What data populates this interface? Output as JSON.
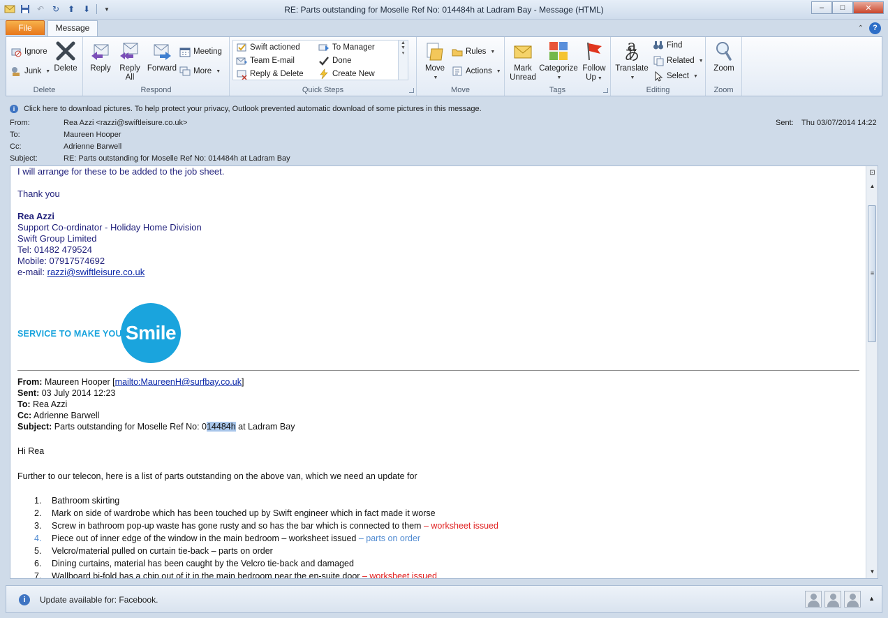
{
  "window": {
    "title": "RE: Parts outstanding for Moselle Ref No:  014484h at Ladram Bay  -  Message (HTML)",
    "controls": {
      "minimize": "–",
      "maximize": "□",
      "close": "✕"
    }
  },
  "tabs": {
    "file": "File",
    "message": "Message"
  },
  "ribbon": {
    "delete_group": {
      "label": "Delete",
      "ignore": "Ignore",
      "junk": "Junk",
      "delete": "Delete"
    },
    "respond_group": {
      "label": "Respond",
      "reply": "Reply",
      "reply_all_1": "Reply",
      "reply_all_2": "All",
      "forward": "Forward",
      "meeting": "Meeting",
      "more": "More"
    },
    "quick_steps": {
      "label": "Quick Steps",
      "items": [
        "Swift actioned",
        "To Manager",
        "Team E-mail",
        "Done",
        "Reply & Delete",
        "Create New"
      ]
    },
    "move_group": {
      "label": "Move",
      "move": "Move",
      "rules": "Rules",
      "actions": "Actions"
    },
    "tags_group": {
      "label": "Tags",
      "mark_unread_1": "Mark",
      "mark_unread_2": "Unread",
      "categorize": "Categorize",
      "follow_up_1": "Follow",
      "follow_up_2": "Up"
    },
    "editing_group": {
      "label": "Editing",
      "translate": "Translate",
      "find": "Find",
      "related": "Related",
      "select": "Select"
    },
    "zoom_group": {
      "label": "Zoom",
      "zoom": "Zoom"
    }
  },
  "infobar": {
    "text": "Click here to download pictures. To help protect your privacy, Outlook prevented automatic download of some pictures in this message."
  },
  "headers": {
    "from_label": "From:",
    "from_value": "Rea Azzi <razzi@swiftleisure.co.uk>",
    "to_label": "To:",
    "to_value": "Maureen Hooper",
    "cc_label": "Cc:",
    "cc_value": "Adrienne Barwell",
    "subject_label": "Subject:",
    "subject_value": "RE: Parts outstanding for Moselle Ref No:  014484h at Ladram Bay",
    "sent_label": "Sent:",
    "sent_value": "Thu 03/07/2014 14:22"
  },
  "body": {
    "line1": "I will arrange for these to be added to the job sheet.",
    "thanks": "Thank you",
    "sig_name": "Rea Azzi",
    "sig_title": "Support Co-ordinator - Holiday Home Division",
    "sig_company": "Swift Group Limited",
    "sig_tel": "Tel: 01482 479524",
    "sig_mobile": "Mobile: 07917574692",
    "sig_email_label": "e-mail: ",
    "sig_email": "razzi@swiftleisure.co.uk",
    "logo_tagline": "SERVICE TO MAKE YOU",
    "logo_word": "Smile",
    "fwd": {
      "from_label": "From:",
      "from_value": "Maureen Hooper [",
      "from_link": "mailto:MaureenH@surfbay.co.uk",
      "from_close": "]",
      "sent_label": "Sent:",
      "sent_value": "03 July 2014 12:23",
      "to_label": "To:",
      "to_value": "Rea Azzi",
      "cc_label": "Cc:",
      "cc_value": "Adrienne Barwell",
      "subject_label": "Subject:",
      "subject_pre": "Parts outstanding for Moselle Ref No: 0",
      "subject_hl": "14484h",
      "subject_post": " at Ladram Bay"
    },
    "greeting": "Hi Rea",
    "intro": "Further to our telecon, here is a list of parts outstanding on the above van, which we need an update for",
    "items": [
      {
        "num": "1.",
        "text": "Bathroom skirting",
        "note": ""
      },
      {
        "num": "2.",
        "text": "Mark on side of wardrobe which has been touched up by Swift engineer which in fact made it worse",
        "note": ""
      },
      {
        "num": "3.",
        "text": "Screw in bathroom pop-up waste has gone rusty and so has the bar which is connected to them ",
        "note": "– worksheet issued"
      },
      {
        "num": "4.",
        "text": "Piece out of inner edge of the window in the main bedroom – worksheet issued ",
        "note": "– parts on order"
      },
      {
        "num": "5.",
        "text": "Velcro/material pulled on curtain tie-back – parts on order",
        "note": ""
      },
      {
        "num": "6.",
        "text": "Dining curtains, material has been caught by the Velcro tie-back and damaged",
        "note": ""
      },
      {
        "num": "7.",
        "text": "Wallboard bi-fold has a chip out of it in the main bedroom near the en-suite door ",
        "note": "– worksheet issued"
      }
    ]
  },
  "statusbar": {
    "text": "Update available for: Facebook."
  }
}
